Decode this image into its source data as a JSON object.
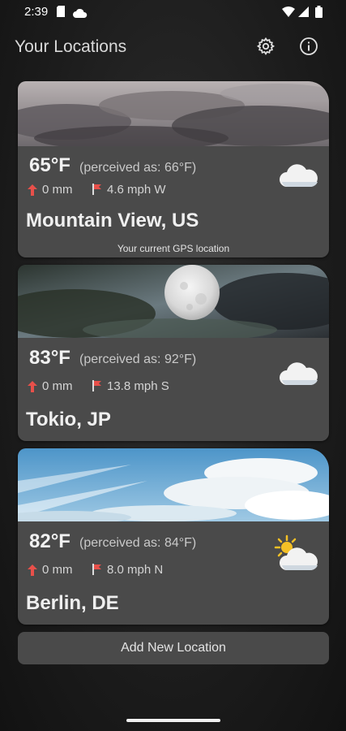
{
  "status_bar": {
    "time": "2:39"
  },
  "app_bar": {
    "title": "Your Locations",
    "settings_icon": "gear-icon",
    "info_icon": "info-icon"
  },
  "locations": [
    {
      "temperature": "65°F",
      "perceived": "(perceived as: 66°F)",
      "precipitation": "0 mm",
      "wind": "4.6 mph W",
      "city": "Mountain View, US",
      "note": "Your current GPS location",
      "weather_icon": "cloud-icon",
      "image": "stormy-clouds"
    },
    {
      "temperature": "83°F",
      "perceived": "(perceived as: 92°F)",
      "precipitation": "0 mm",
      "wind": "13.8 mph S",
      "city": "Tokio, JP",
      "weather_icon": "cloud-icon",
      "image": "night-moon-clouds"
    },
    {
      "temperature": "82°F",
      "perceived": "(perceived as: 84°F)",
      "precipitation": "0 mm",
      "wind": "8.0 mph N",
      "city": "Berlin, DE",
      "weather_icon": "sun-cloud-icon",
      "image": "blue-sky-clouds"
    }
  ],
  "add_button": {
    "label": "Add New Location"
  },
  "colors": {
    "card": "#4a4a4a",
    "background": "#1e1e1e",
    "precip_arrow": "#e8504a",
    "wind_flag": "#e8504a"
  }
}
